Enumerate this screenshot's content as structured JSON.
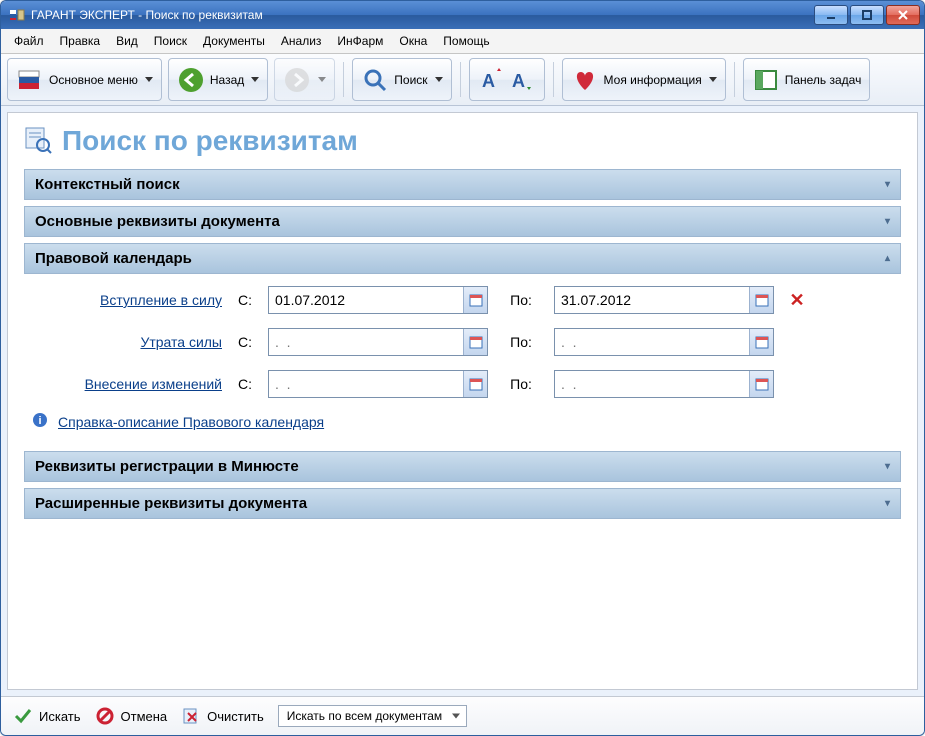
{
  "window": {
    "title": "ГАРАНТ ЭКСПЕРТ - Поиск по реквизитам"
  },
  "menus": [
    "Файл",
    "Правка",
    "Вид",
    "Поиск",
    "Документы",
    "Анализ",
    "ИнФарм",
    "Окна",
    "Помощь"
  ],
  "toolbar": {
    "main_menu": "Основное меню",
    "back": "Назад",
    "search": "Поиск",
    "my_info": "Моя информация",
    "task_panel": "Панель задач"
  },
  "page": {
    "title": "Поиск по реквизитам"
  },
  "sections": {
    "context": {
      "title": "Контекстный поиск",
      "expanded": false
    },
    "basic": {
      "title": "Основные реквизиты документа",
      "expanded": false
    },
    "calendar": {
      "title": "Правовой календарь",
      "expanded": true,
      "help_link": "Справка-описание Правового календаря",
      "rows": [
        {
          "label": "Вступление в силу",
          "from_label": "С:",
          "to_label": "По:",
          "from_value": "01.07.2012",
          "to_value": "31.07.2012",
          "placeholder": ".  .",
          "clear": true
        },
        {
          "label": "Утрата силы",
          "from_label": "С:",
          "to_label": "По:",
          "from_value": "",
          "to_value": "",
          "placeholder": ".  .",
          "clear": false
        },
        {
          "label": "Внесение изменений",
          "from_label": "С:",
          "to_label": "По:",
          "from_value": "",
          "to_value": "",
          "placeholder": ".  .",
          "clear": false
        }
      ]
    },
    "minjust": {
      "title": "Реквизиты регистрации в Минюсте",
      "expanded": false
    },
    "extended": {
      "title": "Расширенные реквизиты документа",
      "expanded": false
    }
  },
  "bottom": {
    "search": "Искать",
    "cancel": "Отмена",
    "clear": "Очистить",
    "scope": "Искать по всем документам"
  }
}
